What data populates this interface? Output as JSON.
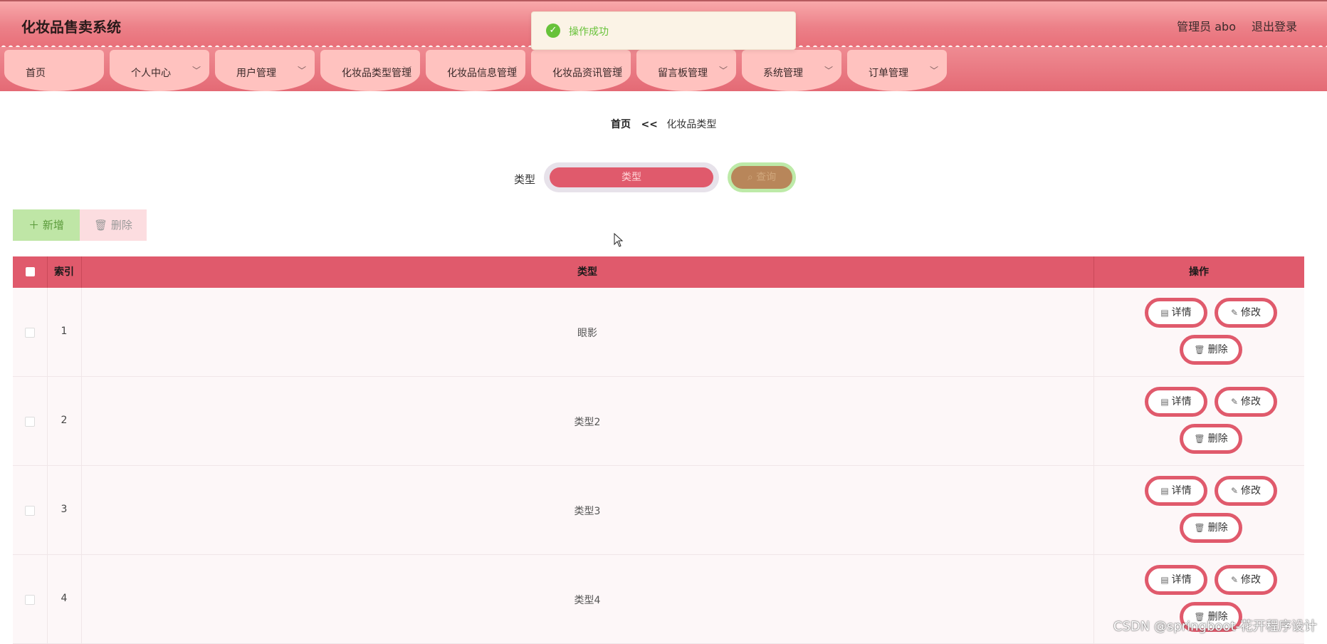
{
  "header": {
    "app_title": "化妆品售卖系统",
    "user_label": "管理员 abo",
    "logout_label": "退出登录"
  },
  "toast": {
    "message": "操作成功",
    "icon": "check-circle-icon"
  },
  "nav": {
    "items": [
      {
        "label": "首页",
        "has_dropdown": false
      },
      {
        "label": "个人中心",
        "has_dropdown": true
      },
      {
        "label": "用户管理",
        "has_dropdown": true
      },
      {
        "label": "化妆品类型管理",
        "has_dropdown": true
      },
      {
        "label": "化妆品信息管理",
        "has_dropdown": true
      },
      {
        "label": "化妆品资讯管理",
        "has_dropdown": true
      },
      {
        "label": "留言板管理",
        "has_dropdown": true
      },
      {
        "label": "系统管理",
        "has_dropdown": true
      },
      {
        "label": "订单管理",
        "has_dropdown": true
      }
    ]
  },
  "breadcrumb": {
    "home": "首页",
    "separator": "<<",
    "current": "化妆品类型"
  },
  "search": {
    "label": "类型",
    "placeholder": "类型",
    "value": "",
    "button_label": "查询",
    "button_icon": "search-icon"
  },
  "actions": {
    "add_label": "新增",
    "delete_label": "删除"
  },
  "table": {
    "headers": {
      "index": "索引",
      "type": "类型",
      "operation": "操作"
    },
    "rows": [
      {
        "index": "1",
        "type": "眼影"
      },
      {
        "index": "2",
        "type": "类型2"
      },
      {
        "index": "3",
        "type": "类型3"
      },
      {
        "index": "4",
        "type": "类型4"
      }
    ],
    "row_actions": {
      "detail": "详情",
      "edit": "修改",
      "delete": "删除"
    }
  },
  "watermark": "CSDN @springboot-花开程序设计",
  "colors": {
    "primary": "#e05a6c",
    "nav_tab": "#ffc2bf",
    "success": "#67c23a",
    "query_button": "#b8865a",
    "add_button": "#bfe6a6",
    "delete_button": "#fcdde0"
  }
}
